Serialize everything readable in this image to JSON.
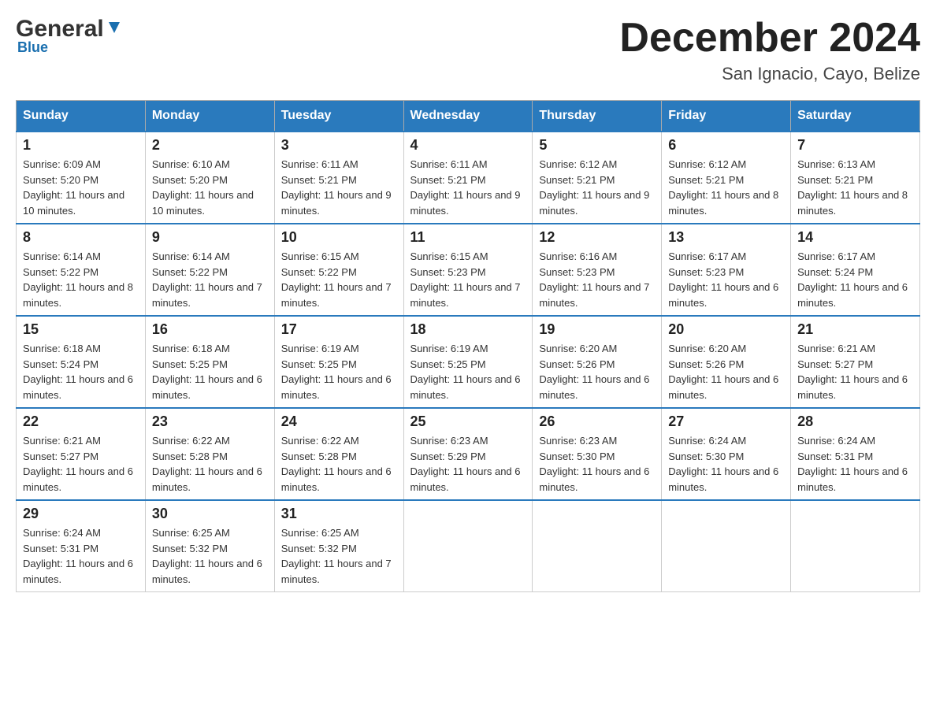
{
  "logo": {
    "brand": "General",
    "sub": "Blue"
  },
  "title": "December 2024",
  "subtitle": "San Ignacio, Cayo, Belize",
  "headers": [
    "Sunday",
    "Monday",
    "Tuesday",
    "Wednesday",
    "Thursday",
    "Friday",
    "Saturday"
  ],
  "weeks": [
    [
      {
        "day": "1",
        "sunrise": "6:09 AM",
        "sunset": "5:20 PM",
        "daylight": "11 hours and 10 minutes."
      },
      {
        "day": "2",
        "sunrise": "6:10 AM",
        "sunset": "5:20 PM",
        "daylight": "11 hours and 10 minutes."
      },
      {
        "day": "3",
        "sunrise": "6:11 AM",
        "sunset": "5:21 PM",
        "daylight": "11 hours and 9 minutes."
      },
      {
        "day": "4",
        "sunrise": "6:11 AM",
        "sunset": "5:21 PM",
        "daylight": "11 hours and 9 minutes."
      },
      {
        "day": "5",
        "sunrise": "6:12 AM",
        "sunset": "5:21 PM",
        "daylight": "11 hours and 9 minutes."
      },
      {
        "day": "6",
        "sunrise": "6:12 AM",
        "sunset": "5:21 PM",
        "daylight": "11 hours and 8 minutes."
      },
      {
        "day": "7",
        "sunrise": "6:13 AM",
        "sunset": "5:21 PM",
        "daylight": "11 hours and 8 minutes."
      }
    ],
    [
      {
        "day": "8",
        "sunrise": "6:14 AM",
        "sunset": "5:22 PM",
        "daylight": "11 hours and 8 minutes."
      },
      {
        "day": "9",
        "sunrise": "6:14 AM",
        "sunset": "5:22 PM",
        "daylight": "11 hours and 7 minutes."
      },
      {
        "day": "10",
        "sunrise": "6:15 AM",
        "sunset": "5:22 PM",
        "daylight": "11 hours and 7 minutes."
      },
      {
        "day": "11",
        "sunrise": "6:15 AM",
        "sunset": "5:23 PM",
        "daylight": "11 hours and 7 minutes."
      },
      {
        "day": "12",
        "sunrise": "6:16 AM",
        "sunset": "5:23 PM",
        "daylight": "11 hours and 7 minutes."
      },
      {
        "day": "13",
        "sunrise": "6:17 AM",
        "sunset": "5:23 PM",
        "daylight": "11 hours and 6 minutes."
      },
      {
        "day": "14",
        "sunrise": "6:17 AM",
        "sunset": "5:24 PM",
        "daylight": "11 hours and 6 minutes."
      }
    ],
    [
      {
        "day": "15",
        "sunrise": "6:18 AM",
        "sunset": "5:24 PM",
        "daylight": "11 hours and 6 minutes."
      },
      {
        "day": "16",
        "sunrise": "6:18 AM",
        "sunset": "5:25 PM",
        "daylight": "11 hours and 6 minutes."
      },
      {
        "day": "17",
        "sunrise": "6:19 AM",
        "sunset": "5:25 PM",
        "daylight": "11 hours and 6 minutes."
      },
      {
        "day": "18",
        "sunrise": "6:19 AM",
        "sunset": "5:25 PM",
        "daylight": "11 hours and 6 minutes."
      },
      {
        "day": "19",
        "sunrise": "6:20 AM",
        "sunset": "5:26 PM",
        "daylight": "11 hours and 6 minutes."
      },
      {
        "day": "20",
        "sunrise": "6:20 AM",
        "sunset": "5:26 PM",
        "daylight": "11 hours and 6 minutes."
      },
      {
        "day": "21",
        "sunrise": "6:21 AM",
        "sunset": "5:27 PM",
        "daylight": "11 hours and 6 minutes."
      }
    ],
    [
      {
        "day": "22",
        "sunrise": "6:21 AM",
        "sunset": "5:27 PM",
        "daylight": "11 hours and 6 minutes."
      },
      {
        "day": "23",
        "sunrise": "6:22 AM",
        "sunset": "5:28 PM",
        "daylight": "11 hours and 6 minutes."
      },
      {
        "day": "24",
        "sunrise": "6:22 AM",
        "sunset": "5:28 PM",
        "daylight": "11 hours and 6 minutes."
      },
      {
        "day": "25",
        "sunrise": "6:23 AM",
        "sunset": "5:29 PM",
        "daylight": "11 hours and 6 minutes."
      },
      {
        "day": "26",
        "sunrise": "6:23 AM",
        "sunset": "5:30 PM",
        "daylight": "11 hours and 6 minutes."
      },
      {
        "day": "27",
        "sunrise": "6:24 AM",
        "sunset": "5:30 PM",
        "daylight": "11 hours and 6 minutes."
      },
      {
        "day": "28",
        "sunrise": "6:24 AM",
        "sunset": "5:31 PM",
        "daylight": "11 hours and 6 minutes."
      }
    ],
    [
      {
        "day": "29",
        "sunrise": "6:24 AM",
        "sunset": "5:31 PM",
        "daylight": "11 hours and 6 minutes."
      },
      {
        "day": "30",
        "sunrise": "6:25 AM",
        "sunset": "5:32 PM",
        "daylight": "11 hours and 6 minutes."
      },
      {
        "day": "31",
        "sunrise": "6:25 AM",
        "sunset": "5:32 PM",
        "daylight": "11 hours and 7 minutes."
      },
      null,
      null,
      null,
      null
    ]
  ]
}
